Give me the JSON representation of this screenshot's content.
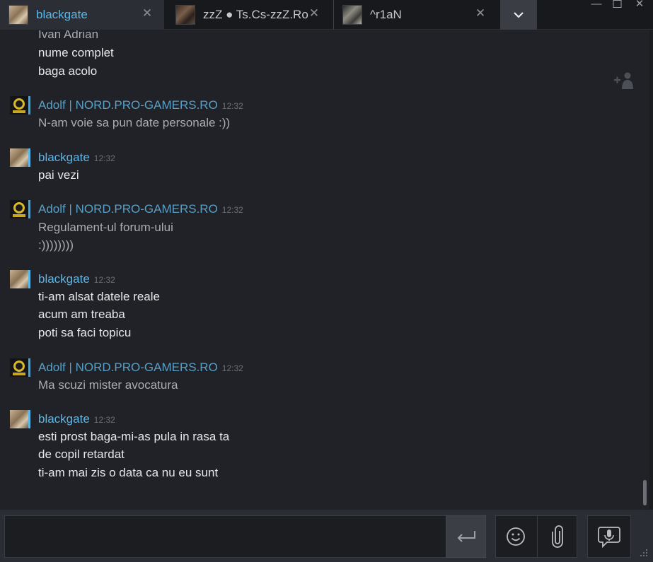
{
  "tabs": [
    {
      "label": "blackgate",
      "active": true
    },
    {
      "label": "zzZ ● Ts.Cs-zzZ.Ro"
    },
    {
      "label": "^r1aN"
    }
  ],
  "colors": {
    "accent": "#59b7e9",
    "other_sender": "#5b9fc6",
    "background": "#202227"
  },
  "partial_lines": [
    "Ivan Adrian",
    "nume complet",
    "baga acolo"
  ],
  "messages": [
    {
      "sender": "Adolf | NORD.PRO-GAMERS.RO",
      "time": "12:32",
      "lines": [
        "N-am voie sa pun date personale :))"
      ]
    },
    {
      "sender": "blackgate",
      "time": "12:32",
      "lines": [
        "pai vezi"
      ]
    },
    {
      "sender": "Adolf | NORD.PRO-GAMERS.RO",
      "time": "12:32",
      "lines": [
        "Regulament-ul forum-ului",
        ":))))))))"
      ]
    },
    {
      "sender": "blackgate",
      "time": "12:32",
      "lines": [
        "ti-am alsat datele reale",
        "acum am treaba",
        "poti sa faci topicu"
      ]
    },
    {
      "sender": "Adolf | NORD.PRO-GAMERS.RO",
      "time": "12:32",
      "lines": [
        "Ma scuzi mister avocatura"
      ]
    },
    {
      "sender": "blackgate",
      "time": "12:32",
      "lines": [
        "esti prost baga-mi-as pula in rasa ta",
        "de copil retardat",
        "ti-am mai zis o data ca nu eu sunt"
      ]
    }
  ],
  "icons": {
    "add_friend": "add-friend-icon",
    "send": "enter-icon",
    "emoji": "smiley-icon",
    "attach": "paperclip-icon",
    "voice": "microphone-icon"
  }
}
